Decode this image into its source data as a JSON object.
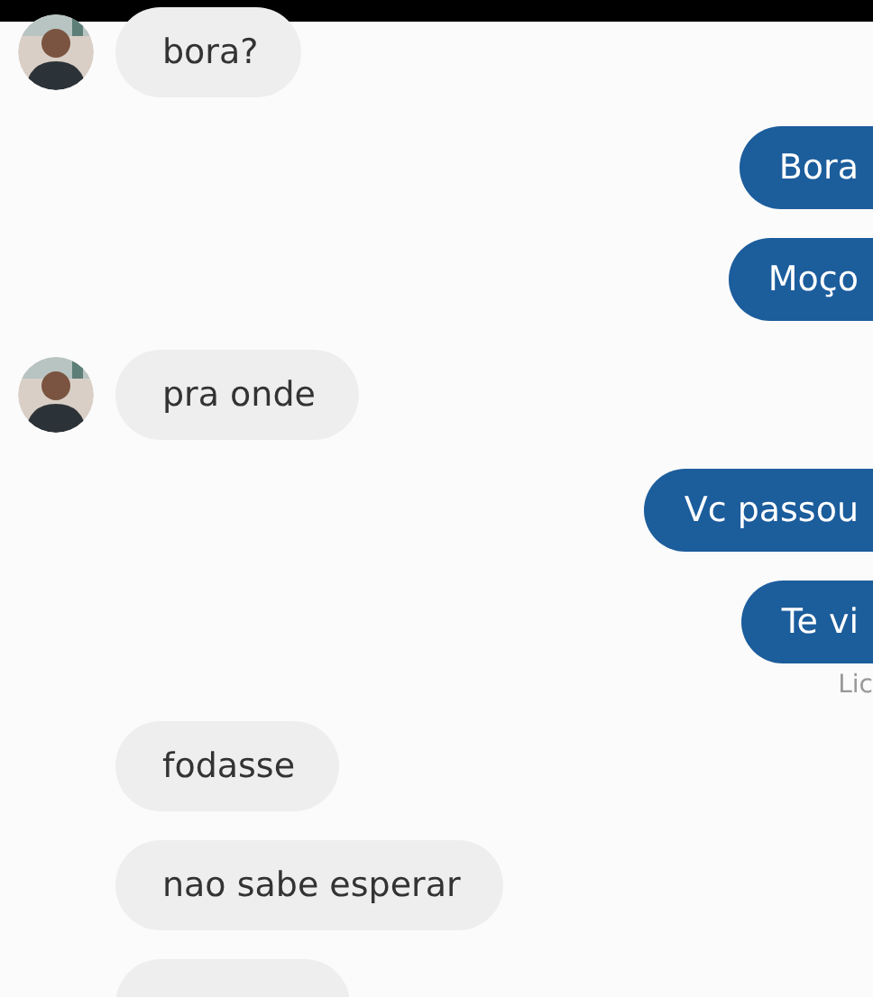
{
  "messages": [
    {
      "kind": "incoming",
      "avatar": true,
      "text": "bora?"
    },
    {
      "kind": "outgoing",
      "text": "Bora"
    },
    {
      "kind": "outgoing",
      "text": "Moço"
    },
    {
      "kind": "incoming",
      "avatar": true,
      "text": "pra onde"
    },
    {
      "kind": "outgoing",
      "text": "Vc passou"
    },
    {
      "kind": "outgoing",
      "text": "Te vi",
      "status": "Lic"
    },
    {
      "kind": "incoming",
      "avatar": false,
      "text": "fodasse"
    },
    {
      "kind": "incoming",
      "avatar": false,
      "text": "nao sabe esperar"
    },
    {
      "kind": "incoming",
      "avatar": false,
      "cut": true
    }
  ]
}
